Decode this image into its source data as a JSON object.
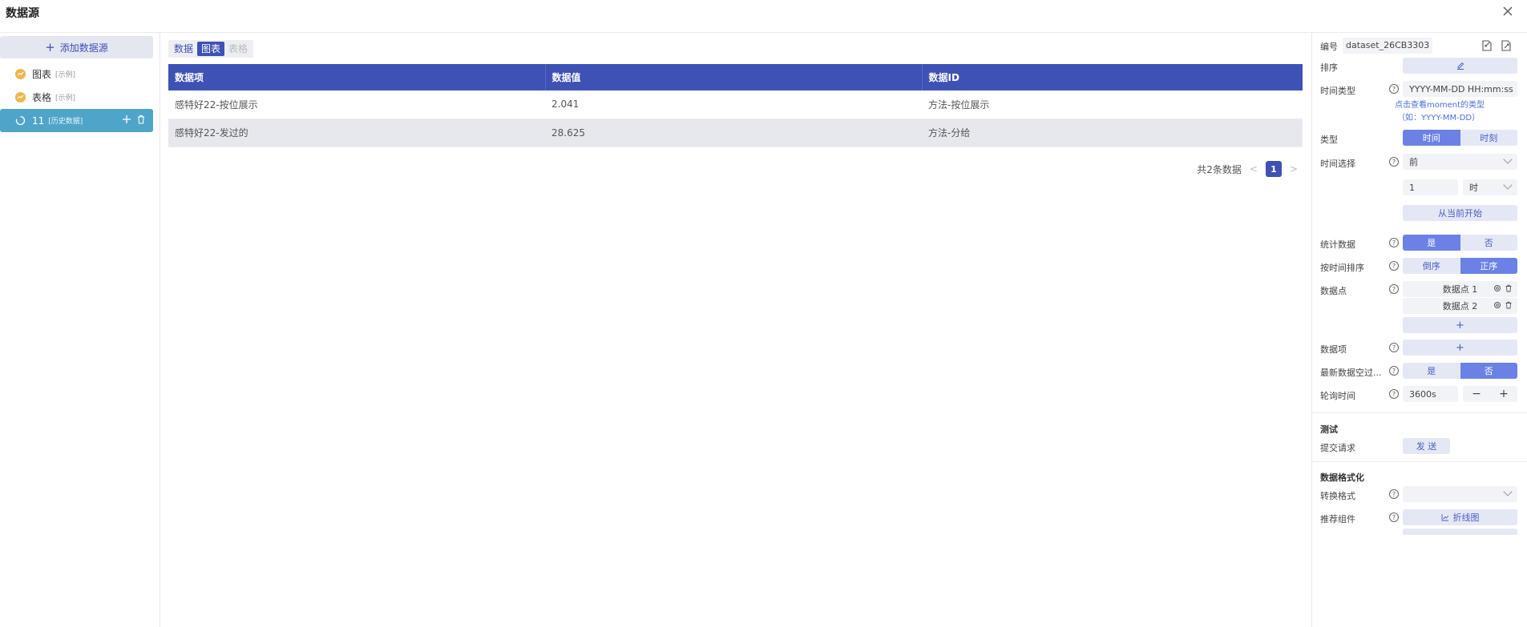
{
  "window": {
    "title": "数据源",
    "close_icon": "close-icon"
  },
  "left": {
    "add_label": "添加数据源",
    "items": [
      {
        "name": "图表",
        "tag": "[示例]"
      },
      {
        "name": "表格",
        "tag": "[示例]"
      },
      {
        "name": "11",
        "tag": "[历史数据]"
      }
    ]
  },
  "center": {
    "tabs": [
      {
        "label": "数据"
      },
      {
        "label": "图表"
      },
      {
        "label": "表格"
      }
    ],
    "table": {
      "headers": [
        "数据项",
        "数据值",
        "数据ID"
      ],
      "rows": [
        [
          "感特好22-按位展示",
          "2.041",
          "方法-按位展示"
        ],
        [
          "感特好22-发过的",
          "28.625",
          "方法-分给"
        ]
      ]
    },
    "pager": {
      "total": "共2条数据",
      "page": "1"
    }
  },
  "right": {
    "id_label": "编号",
    "id_value": "dataset_26CB3303",
    "sort_label": "排序",
    "time_type_label": "时间类型",
    "time_type_value": "YYYY-MM-DD HH:mm:ss",
    "moment_link": "点击查看moment的类型",
    "moment_example": "（如：YYYY-MM-DD）",
    "type_label": "类型",
    "type_options": [
      "时间",
      "时刻"
    ],
    "time_select_label": "时间选择",
    "time_select_value": "前",
    "time_num": "1",
    "time_unit": "时",
    "from_now": "从当前开始",
    "stats_label": "统计数据",
    "stats_options": [
      "是",
      "否"
    ],
    "time_sort_label": "按时间排序",
    "time_sort_options": [
      "倒序",
      "正序"
    ],
    "points_label": "数据点",
    "points": [
      "数据点 1",
      "数据点 2"
    ],
    "items_label": "数据项",
    "latest_label": "最新数据空过...",
    "latest_options": [
      "是",
      "否"
    ],
    "poll_label": "轮询时间",
    "poll_value": "3600s",
    "test_section": "测试",
    "submit_label": "提交请求",
    "send_label": "发 送",
    "format_section": "数据格式化",
    "convert_label": "转换格式",
    "recommend_label": "推荐组件",
    "recommend_value": "折线图"
  }
}
